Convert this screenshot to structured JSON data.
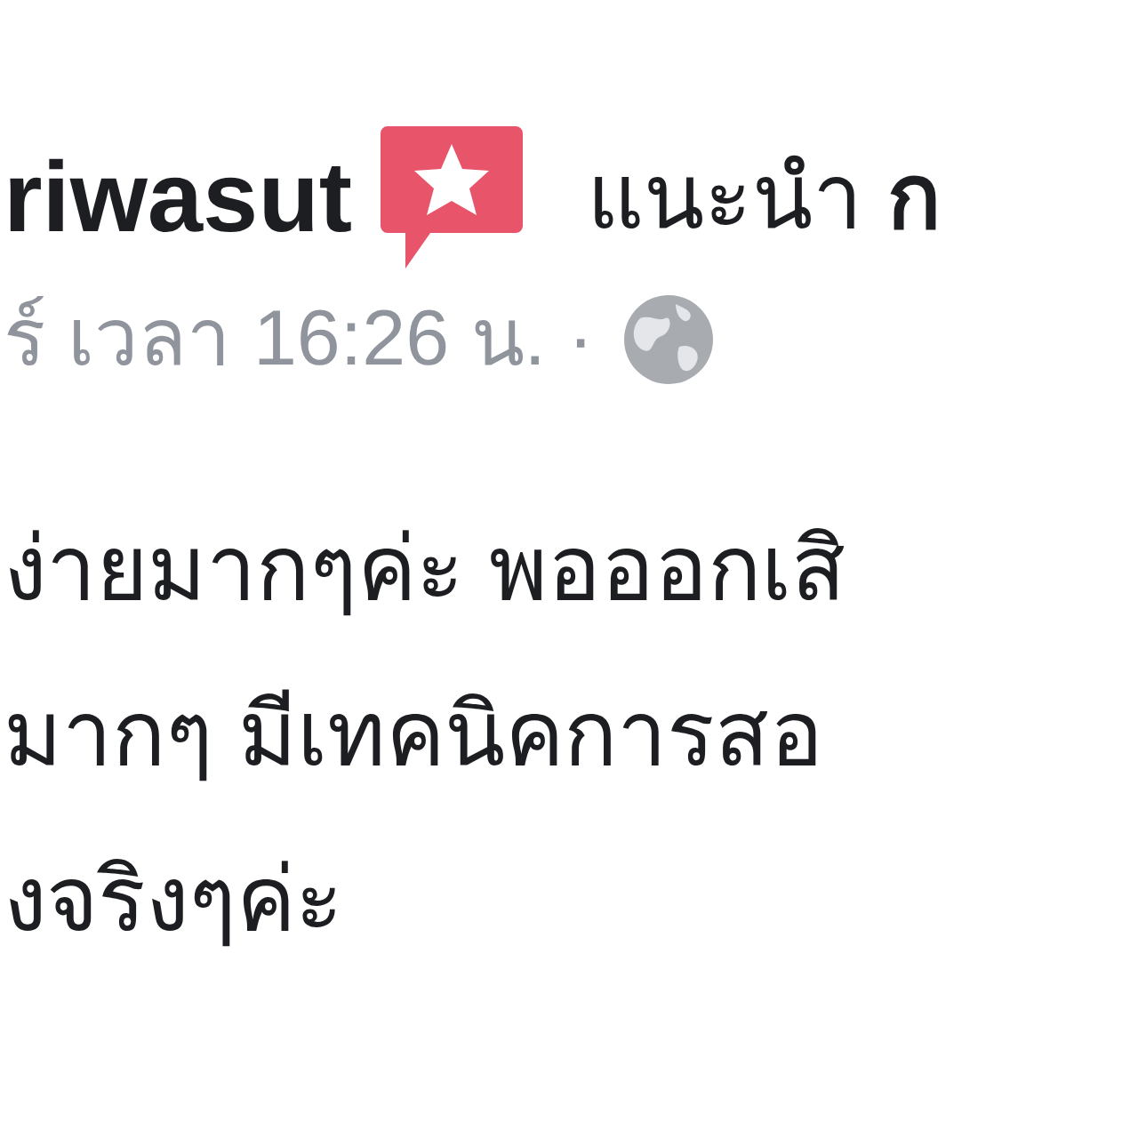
{
  "post": {
    "author": "riwasut",
    "action": "แนะนำ",
    "target": "ก",
    "meta": "ร์ เวลา 16:26 น. ·",
    "body_lines": [
      "ง่ายมากๆค่ะ พอออกเสิ",
      "มากๆ มีเทคนิคการสอ",
      "งจริงๆค่ะ"
    ]
  }
}
